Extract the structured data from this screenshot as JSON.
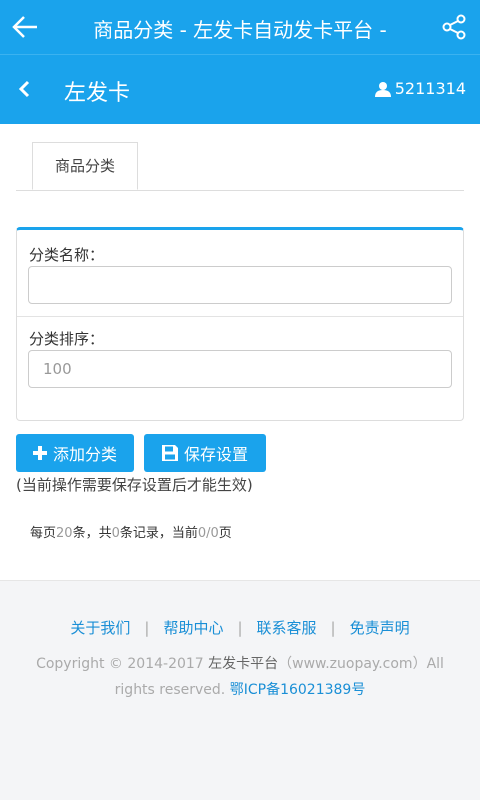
{
  "app_bar": {
    "title": "商品分类 - 左发卡自动发卡平台 -"
  },
  "sub_bar": {
    "brand": "左发卡",
    "user_id": "5211314"
  },
  "tabs": [
    {
      "label": "商品分类"
    }
  ],
  "form": {
    "name_label": "分类名称：",
    "name_value": "",
    "order_label": "分类排序：",
    "order_placeholder": "100"
  },
  "buttons": {
    "add_label": "添加分类",
    "save_label": "保存设置"
  },
  "note": "(当前操作需要保存设置后才能生效)",
  "pager": {
    "prefix": "每页",
    "per_page": "20",
    "mid1": "条，共",
    "total": "0",
    "mid2": "条记录，当前",
    "page": "0/0",
    "suffix": "页"
  },
  "footer": {
    "links": [
      "关于我们",
      "帮助中心",
      "联系客服",
      "免责声明"
    ],
    "copyright_prefix": "Copyright © 2014-2017",
    "copyright_brand": "左发卡平台",
    "copyright_site": "（www.zuopay.com）All rights reserved.",
    "icp": "鄂ICP备16021389号"
  },
  "colors": {
    "primary": "#1aa3ec",
    "link": "#1a8fd6"
  }
}
